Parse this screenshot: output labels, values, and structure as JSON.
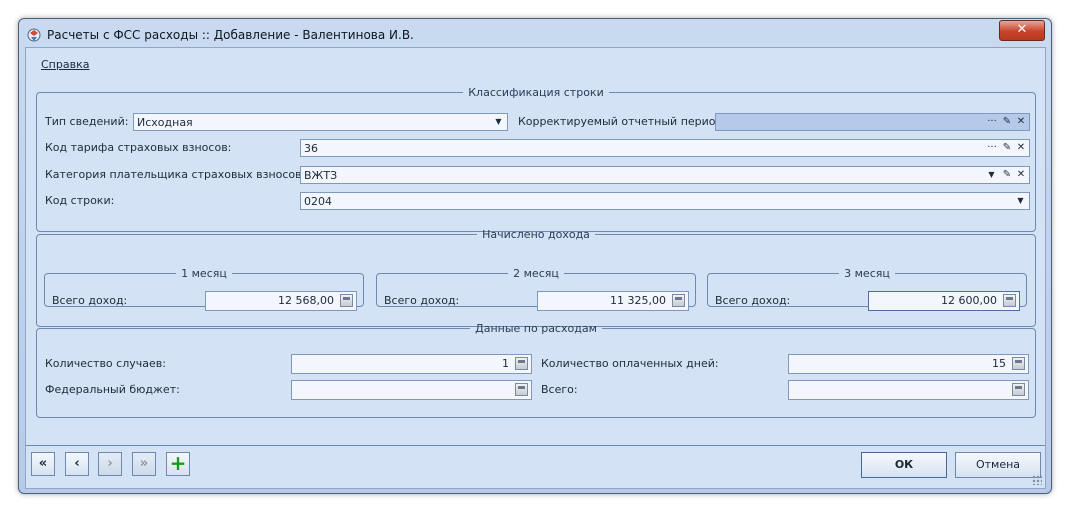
{
  "window": {
    "title": "Расчеты с ФСС расходы :: Добавление - Валентинова И.В.",
    "close_glyph": "✕"
  },
  "menu": {
    "help": "Справка"
  },
  "classification": {
    "legend": "Классификация строки",
    "info_type_label": "Тип сведений:",
    "info_type_value": "Исходная",
    "corrected_period_label": "Корректируемый отчетный период:",
    "corrected_period_value": "",
    "tariff_code_label": "Код тарифа страховых взносов:",
    "tariff_code_value": "36",
    "payer_category_label": "Категория плательщика страховых взносов:",
    "payer_category_value": "ВЖТЗ",
    "row_code_label": "Код строки:",
    "row_code_value": "0204"
  },
  "income": {
    "legend": "Начислено дохода",
    "months": [
      {
        "legend": "1 месяц",
        "label": "Всего доход:",
        "value": "12 568,00"
      },
      {
        "legend": "2 месяц",
        "label": "Всего доход:",
        "value": "11 325,00"
      },
      {
        "legend": "3 месяц",
        "label": "Всего доход:",
        "value": "12 600,00"
      }
    ]
  },
  "expenses": {
    "legend": "Данные по расходам",
    "cases_label": "Количество случаев:",
    "cases_value": "1",
    "paid_days_label": "Количество оплаченных дней:",
    "paid_days_value": "15",
    "federal_label": "Федеральный бюджет:",
    "federal_value": "",
    "total_label": "Всего:",
    "total_value": ""
  },
  "icons": {
    "dropdown": "▼",
    "ellipsis": "···",
    "pick": "✎",
    "clear": "✕"
  },
  "nav": {
    "first": "«",
    "prev": "‹",
    "next": "›",
    "last": "»",
    "add": "+"
  },
  "buttons": {
    "ok": "ОК",
    "cancel": "Отмена"
  }
}
